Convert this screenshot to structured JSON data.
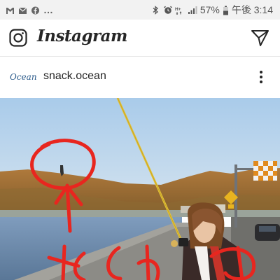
{
  "status_bar": {
    "more_indicator": "…",
    "battery_percent": "57%",
    "time": "午後 3:14",
    "network_label": "H+",
    "icons": [
      "gmail-icon",
      "mail-icon",
      "facebook-icon",
      "bluetooth-icon",
      "alarm-icon",
      "signal-icon",
      "battery-icon"
    ]
  },
  "header": {
    "brand": "Instagram",
    "icons": [
      "camera-icon",
      "direct-message-icon"
    ]
  },
  "post": {
    "avatar_text": "Ocean",
    "username": "snack.ocean",
    "menu_icon": "more-vertical-icon"
  },
  "colors": {
    "annotation_red": "#e8261f",
    "sky": "#bcd6ee",
    "sea": "#6f8fb0",
    "rod_yellow": "#e3c23a"
  }
}
